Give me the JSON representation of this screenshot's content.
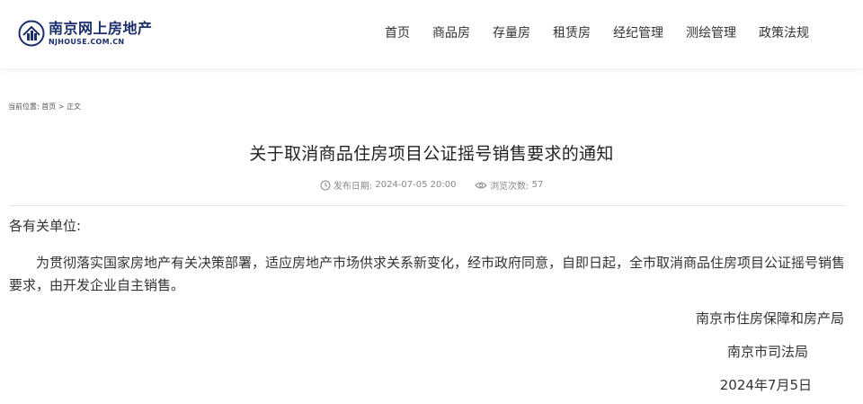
{
  "header": {
    "logo_cn": "南京网上房地产",
    "logo_en": "NJHOUSE.COM.CN",
    "logo_icon": "house-building-logo",
    "nav": [
      "首页",
      "商品房",
      "存量房",
      "租赁房",
      "经纪管理",
      "测绘管理",
      "政策法规"
    ]
  },
  "breadcrumb": {
    "prefix": "当前位置:",
    "home": "首页",
    "separator": ">",
    "current": "正文"
  },
  "article": {
    "title": "关于取消商品住房项目公证摇号销售要求的通知",
    "publish_label": "发布日期:",
    "publish_date": "2024-07-05 20:00",
    "views_label": "浏览次数:",
    "views": "57",
    "salutation": "各有关单位:",
    "paragraph": "为贯彻落实国家房地产有关决策部署，适应房地产市场供求关系新变化，经市政府同意，自即日起，全市取消商品住房项目公证摇号销售要求，由开发企业自主销售。",
    "signatures": [
      "南京市住房保障和房产局",
      "南京市司法局"
    ],
    "date": "2024年7月5日"
  },
  "colors": {
    "logo": "#1b2f6b",
    "text": "#333333",
    "meta": "#888888",
    "divider": "#e4e4e4"
  }
}
